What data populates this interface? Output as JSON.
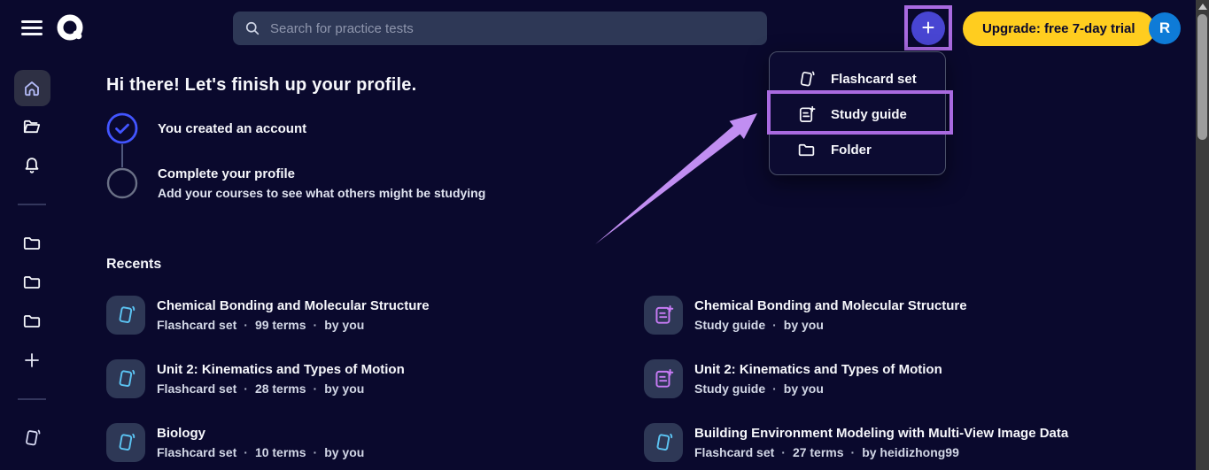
{
  "topbar": {
    "search_placeholder": "Search for practice tests",
    "plus_label": "+",
    "upgrade_label": "Upgrade: free 7-day trial",
    "avatar_initial": "R"
  },
  "create_menu": {
    "items": [
      {
        "label": "Flashcard set"
      },
      {
        "label": "Study guide"
      },
      {
        "label": "Folder"
      }
    ]
  },
  "profile": {
    "heading": "Hi there! Let's finish up your profile.",
    "step1_title": "You created an account",
    "step2_title": "Complete your profile",
    "step2_subtitle": "Add your courses to see what others might be studying"
  },
  "recents": {
    "heading": "Recents",
    "separator": "·",
    "items": [
      {
        "title": "Chemical Bonding and Molecular Structure",
        "meta": [
          "Flashcard set",
          "99 terms",
          "by you"
        ],
        "icon": "flashcard-icon"
      },
      {
        "title": "Chemical Bonding and Molecular Structure",
        "meta": [
          "Study guide",
          "by you"
        ],
        "icon": "study-guide-icon"
      },
      {
        "title": "Unit 2: Kinematics and Types of Motion",
        "meta": [
          "Flashcard set",
          "28 terms",
          "by you"
        ],
        "icon": "flashcard-icon"
      },
      {
        "title": "Unit 2: Kinematics and Types of Motion",
        "meta": [
          "Study guide",
          "by you"
        ],
        "icon": "study-guide-icon"
      },
      {
        "title": "Biology",
        "meta": [
          "Flashcard set",
          "10 terms",
          "by you"
        ],
        "icon": "flashcard-icon"
      },
      {
        "title": "Building Environment Modeling with Multi-View Image Data",
        "meta": [
          "Flashcard set",
          "27 terms",
          "by heidizhong99"
        ],
        "icon": "flashcard-icon"
      }
    ]
  },
  "colors": {
    "background": "#0a092d",
    "surface": "#2e3856",
    "highlight_purple": "#a96ae0",
    "arrow_purple": "#c18ef2",
    "plus_button_blue": "#4845d2",
    "upgrade_yellow": "#ffcd1f",
    "avatar_blue": "#0e7bd7",
    "check_blue": "#4255ff",
    "flashcard_blue": "#5bc3f2",
    "study_guide_purple": "#c77bf5"
  }
}
